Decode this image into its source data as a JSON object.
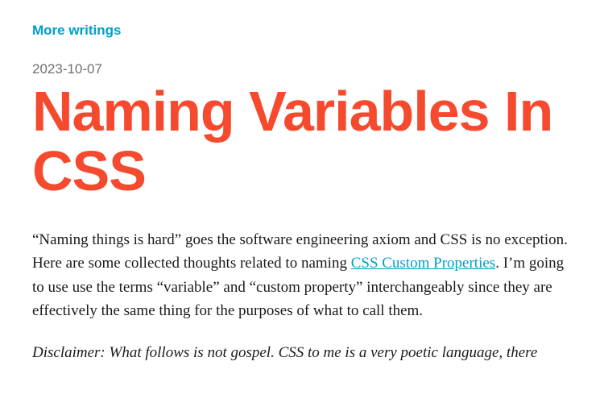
{
  "nav": {
    "back_label": "More writings"
  },
  "article": {
    "date": "2023-10-07",
    "title": "Naming Variables In CSS",
    "intro_before_link": "“Naming things is hard” goes the software engineering axiom and CSS is no exception. Here are some collected thoughts related to naming ",
    "intro_link_text": "CSS Custom Properties",
    "intro_after_link": ". I’m going to use use the terms “variable” and “custom property” interchangeably since they are effectively the same thing for the purposes of what to call them.",
    "disclaimer": "Disclaimer: What follows is not gospel. CSS to me is a very poetic language, there"
  }
}
